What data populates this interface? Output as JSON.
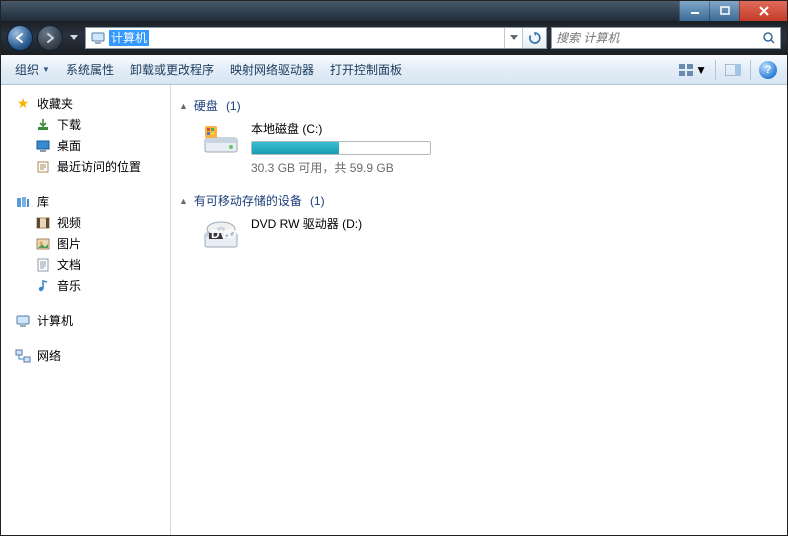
{
  "titlebar": {},
  "address": {
    "path_text": "计算机"
  },
  "search": {
    "placeholder": "搜索 计算机"
  },
  "toolbar": {
    "organize": "组织",
    "system_properties": "系统属性",
    "uninstall_change": "卸载或更改程序",
    "map_network_drive": "映射网络驱动器",
    "open_control_panel": "打开控制面板"
  },
  "sidebar": {
    "favorites": {
      "label": "收藏夹",
      "items": [
        {
          "label": "下载"
        },
        {
          "label": "桌面"
        },
        {
          "label": "最近访问的位置"
        }
      ]
    },
    "libraries": {
      "label": "库",
      "items": [
        {
          "label": "视频"
        },
        {
          "label": "图片"
        },
        {
          "label": "文档"
        },
        {
          "label": "音乐"
        }
      ]
    },
    "computer": {
      "label": "计算机"
    },
    "network": {
      "label": "网络"
    }
  },
  "content": {
    "hard_disks": {
      "header": "硬盘",
      "count_text": "(1)",
      "drives": [
        {
          "name": "本地磁盘 (C:)",
          "free_text": "30.3 GB 可用，共 59.9 GB",
          "fill_percent": 49
        }
      ]
    },
    "removable": {
      "header": "有可移动存储的设备",
      "count_text": "(1)",
      "drives": [
        {
          "name": "DVD RW 驱动器 (D:)"
        }
      ]
    }
  }
}
